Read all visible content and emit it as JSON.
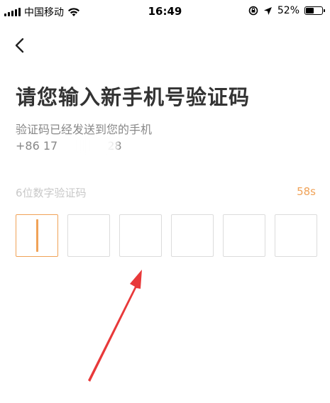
{
  "status_bar": {
    "carrier": "中国移动",
    "time": "16:49",
    "battery_percent": "52%",
    "battery_level": 0.52
  },
  "header": {
    "back_icon": "chevron-left-icon"
  },
  "main": {
    "title": "请您输入新手机号验证码",
    "hint_line1": "验证码已经发送到您的手机",
    "phone_prefix": "+86 17",
    "phone_suffix": "28",
    "code_label": "6位数字验证码",
    "countdown": "58s",
    "code_digits": [
      "",
      "",
      "",
      "",
      "",
      ""
    ],
    "active_box_index": 0
  },
  "colors": {
    "accent": "#f0a257",
    "annotation_arrow": "#e8393a",
    "box_border": "#dcdcdc",
    "placeholder": "#c8c8c8"
  }
}
